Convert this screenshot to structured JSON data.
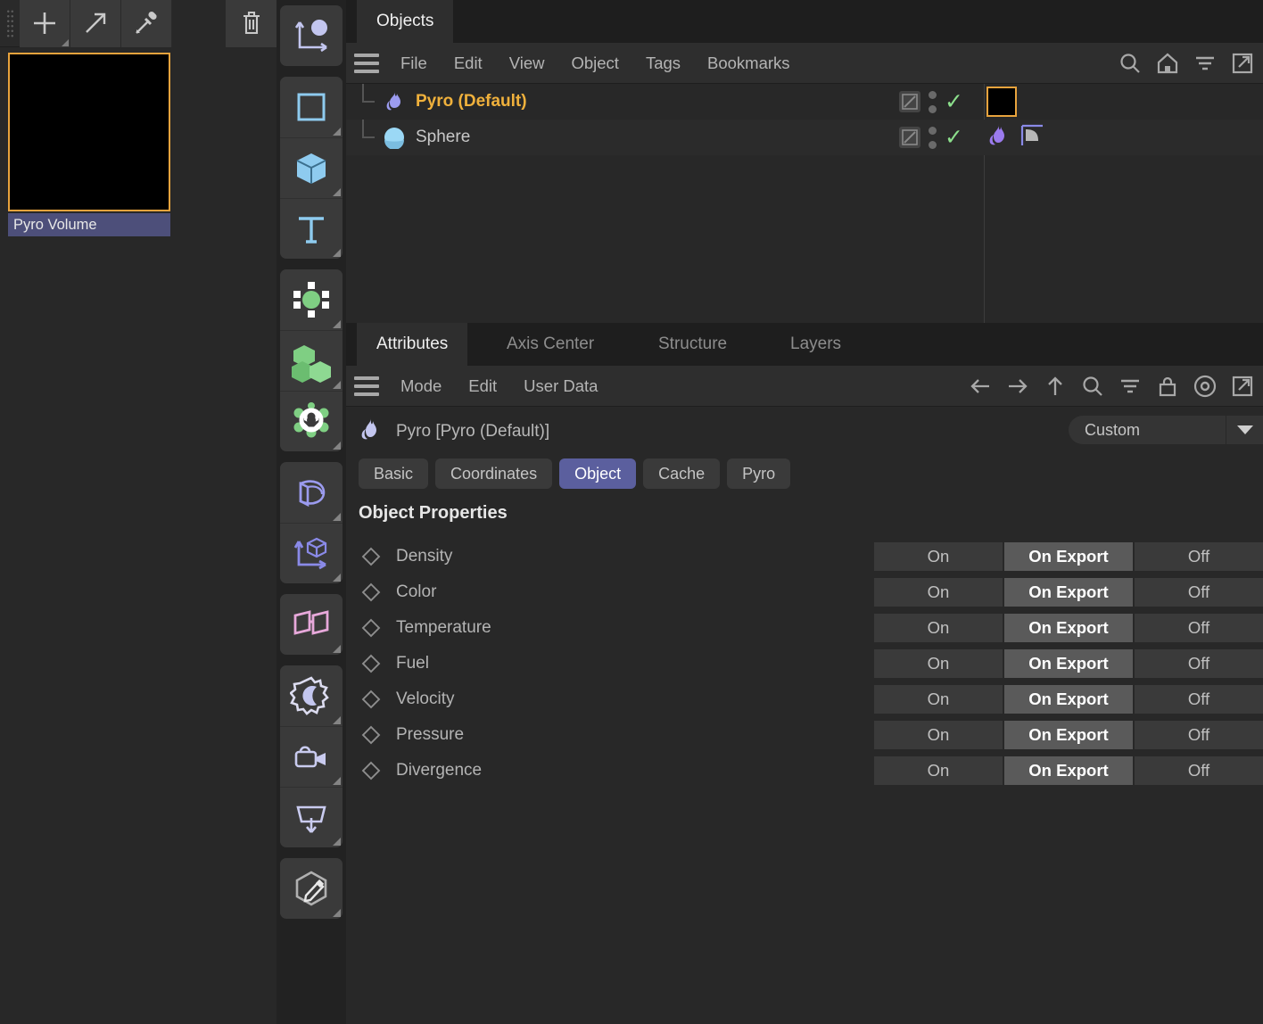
{
  "material_manager": {
    "toolbar": [
      {
        "name": "add-material-button",
        "icon": "plus-icon",
        "has_menu": true
      },
      {
        "name": "apply-material-button",
        "icon": "arrow-up-right-icon",
        "has_menu": false
      },
      {
        "name": "pick-material-button",
        "icon": "eyedropper-icon",
        "has_menu": false
      },
      {
        "name": "delete-material-button",
        "icon": "trash-icon",
        "has_menu": false
      }
    ],
    "material": {
      "label": "Pyro Volume",
      "swatch_color": "#000000",
      "selected_border": "#e8a33d"
    }
  },
  "icon_toolbar": {
    "groups": [
      {
        "items": [
          {
            "name": "axis-object-icon",
            "label": "Null / Axis Object",
            "color": "#c3c6ef",
            "menu": false
          }
        ]
      },
      {
        "items": [
          {
            "name": "spline-rect-icon",
            "label": "Spline Primitives",
            "color": "#8ecbef",
            "menu": true
          },
          {
            "name": "cube-icon",
            "label": "Parametric Primitives",
            "color": "#8ecbef",
            "menu": true
          },
          {
            "name": "text-icon",
            "label": "Text Object",
            "color": "#8ecbef",
            "menu": true
          }
        ]
      },
      {
        "items": [
          {
            "name": "generator-icon",
            "label": "Generators",
            "color": "#7fcf83",
            "menu": true
          },
          {
            "name": "cloner-icon",
            "label": "MoGraph",
            "color": "#7fcf83",
            "menu": true
          },
          {
            "name": "simulation-gear-icon",
            "label": "Simulation",
            "color": "#7fcf83",
            "menu": true
          }
        ]
      },
      {
        "items": [
          {
            "name": "deformer-icon",
            "label": "Deformers",
            "color": "#9b9bef",
            "menu": true
          },
          {
            "name": "axis-cube-icon",
            "label": "Scene Nodes",
            "color": "#8a8ae8",
            "menu": true
          }
        ]
      },
      {
        "items": [
          {
            "name": "field-icon",
            "label": "Fields",
            "color": "#e7a8da",
            "menu": true
          }
        ]
      },
      {
        "items": [
          {
            "name": "light-icon",
            "label": "Light",
            "color": "#c3c6ef",
            "menu": true
          },
          {
            "name": "camera-icon",
            "label": "Camera",
            "color": "#c3c6ef",
            "menu": true
          },
          {
            "name": "stage-icon",
            "label": "Environment",
            "color": "#c3c6ef",
            "menu": true
          }
        ]
      },
      {
        "items": [
          {
            "name": "edit-render-settings-icon",
            "label": "Edit Render Settings",
            "color": "#b0b0b0",
            "menu": true
          }
        ]
      }
    ]
  },
  "objects_panel": {
    "tabs": [
      {
        "label": "Objects",
        "active": true
      }
    ],
    "menu": [
      "File",
      "Edit",
      "View",
      "Object",
      "Tags",
      "Bookmarks"
    ],
    "tools": [
      "search-icon",
      "home-icon",
      "filter-icon",
      "edit-external-icon"
    ],
    "rows": [
      {
        "name": "Pyro (Default)",
        "icon": "pyro-flame-icon",
        "selected": true,
        "visible_dots": true,
        "enabled_check": true,
        "tags": [
          {
            "type": "color-swatch",
            "color": "#000000",
            "selected": true
          }
        ]
      },
      {
        "name": "Sphere",
        "icon": "sphere-icon",
        "selected": false,
        "visible_dots": true,
        "enabled_check": true,
        "tags": [
          {
            "type": "pyro-tag-icon"
          },
          {
            "type": "phong-tag-icon"
          }
        ]
      }
    ]
  },
  "attributes_panel": {
    "tabs": [
      {
        "label": "Attributes",
        "active": true
      },
      {
        "label": "Axis Center",
        "active": false
      },
      {
        "label": "Structure",
        "active": false
      },
      {
        "label": "Layers",
        "active": false
      }
    ],
    "menu": [
      "Mode",
      "Edit",
      "User Data"
    ],
    "tools": [
      "back-arrow-icon",
      "forward-arrow-icon",
      "up-arrow-icon",
      "search-icon",
      "filter-icon",
      "lock-icon",
      "record-circle-icon",
      "edit-external-icon"
    ],
    "object_header": {
      "icon": "pyro-flame-icon",
      "title": "Pyro [Pyro (Default)]"
    },
    "preset": {
      "value": "Custom",
      "placeholder": "Custom"
    },
    "property_tabs": [
      {
        "label": "Basic",
        "active": false
      },
      {
        "label": "Coordinates",
        "active": false
      },
      {
        "label": "Object",
        "active": true
      },
      {
        "label": "Cache",
        "active": false
      },
      {
        "label": "Pyro",
        "active": false
      }
    ],
    "section_title": "Object Properties",
    "segment_options": [
      "On",
      "On Export",
      "Off"
    ],
    "properties": [
      {
        "label": "Density",
        "selected": "On Export"
      },
      {
        "label": "Color",
        "selected": "On Export"
      },
      {
        "label": "Temperature",
        "selected": "On Export"
      },
      {
        "label": "Fuel",
        "selected": "On Export"
      },
      {
        "label": "Velocity",
        "selected": "On Export"
      },
      {
        "label": "Pressure",
        "selected": "On Export"
      },
      {
        "label": "Divergence",
        "selected": "On Export"
      }
    ]
  },
  "colors": {
    "background": "#282828",
    "panel_dark": "#1e1e1e",
    "accent_selected": "#5b5f9e",
    "accent_object_selected": "#f0b13c",
    "check_green": "#8ce08c",
    "material_label_bg": "#4d4f7a"
  }
}
